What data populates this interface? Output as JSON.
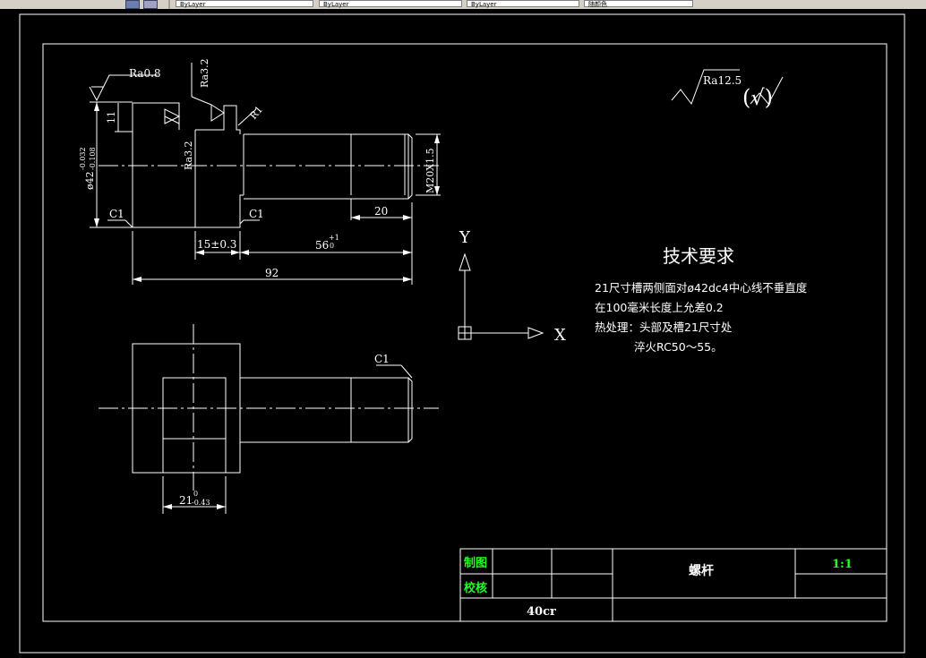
{
  "toolbar": {
    "combo_1": "ByLayer",
    "combo_2": "ByLayer",
    "combo_3": "ByLayer",
    "combo_4": "随颜色"
  },
  "drawing": {
    "surface_roughness": {
      "ra08": "Ra0.8",
      "ra32_top": "Ra3.2",
      "ra32_face": "Ra3.2",
      "ra125": "Ra12.5",
      "check": "(√)"
    },
    "dimensions": {
      "height_11": "11",
      "dia_main": "ø42",
      "dia_tol_upper": "-0.032",
      "dia_tol_lower": "-0.108",
      "r1": "R1",
      "c1_left": "C1",
      "c1_mid": "C1",
      "c1_plan": "C1",
      "thread": "M20X1.5",
      "len_20": "20",
      "len_15": "15±0.3",
      "len_56": "56",
      "len_56_tol_upper": "+1",
      "len_56_tol_lower": "0",
      "len_92": "92",
      "width_21": "21",
      "width_21_tol_upper": "0",
      "width_21_tol_lower": "-0.43"
    },
    "ucs": {
      "y_label": "Y",
      "x_label": "X"
    },
    "technical_requirements": {
      "title": "技术要求",
      "line1": "21尺寸槽两侧面对ø42dc4中心线不垂直度",
      "line2": "在100毫米长度上允差0.2",
      "line3": "热处理：头部及槽21尺寸处",
      "line4": "淬火RC50～55。"
    },
    "title_block": {
      "drawn_label": "制图",
      "checked_label": "校核",
      "part_name": "螺杆",
      "scale": "1:1",
      "material": "40cr"
    }
  }
}
